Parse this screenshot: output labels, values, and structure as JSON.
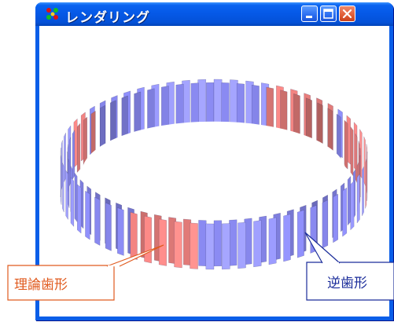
{
  "window": {
    "title": "レンダリング",
    "icon": "render-app-icon",
    "buttons": [
      "minimize-icon",
      "maximize-icon",
      "close-icon"
    ]
  },
  "render": {
    "object": "ring-gear-3d",
    "colors": {
      "theoretical_tooth": "#e07a78",
      "inverse_tooth": "#8888ee"
    }
  },
  "callouts": {
    "left": {
      "text": "理論歯形",
      "color": "#e05a1e"
    },
    "right": {
      "text": "逆歯形",
      "color": "#1a2c9a"
    }
  }
}
